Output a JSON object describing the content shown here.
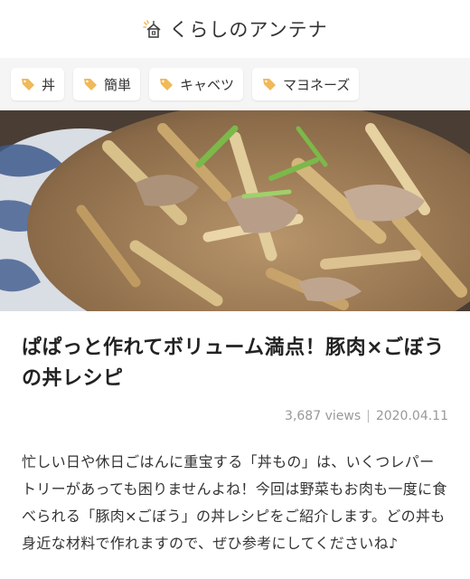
{
  "header": {
    "site_name": "くらしのアンテナ",
    "logo_icon": "house-antenna-icon"
  },
  "tags": [
    {
      "label": "丼",
      "icon": "tag-icon"
    },
    {
      "label": "簡単",
      "icon": "tag-icon"
    },
    {
      "label": "キャベツ",
      "icon": "tag-icon"
    },
    {
      "label": "マヨネーズ",
      "icon": "tag-icon"
    }
  ],
  "article": {
    "title": "ぱぱっと作れてボリューム満点！豚肉×ごぼうの丼レシピ",
    "views": "3,687 views",
    "separator": "|",
    "date": "2020.04.11",
    "description": "忙しい日や休日ごはんに重宝する「丼もの」は、いくつレパートリーがあっても困りませんよね！今回は野菜もお肉も一度に食べられる「豚肉×ごぼう」の丼レシピをご紹介します。どの丼も身近な材料で作れますので、ぜひ参考にしてくださいね♪"
  },
  "colors": {
    "accent": "#f0b95a",
    "tag_bar_bg": "#f5f5f5"
  }
}
